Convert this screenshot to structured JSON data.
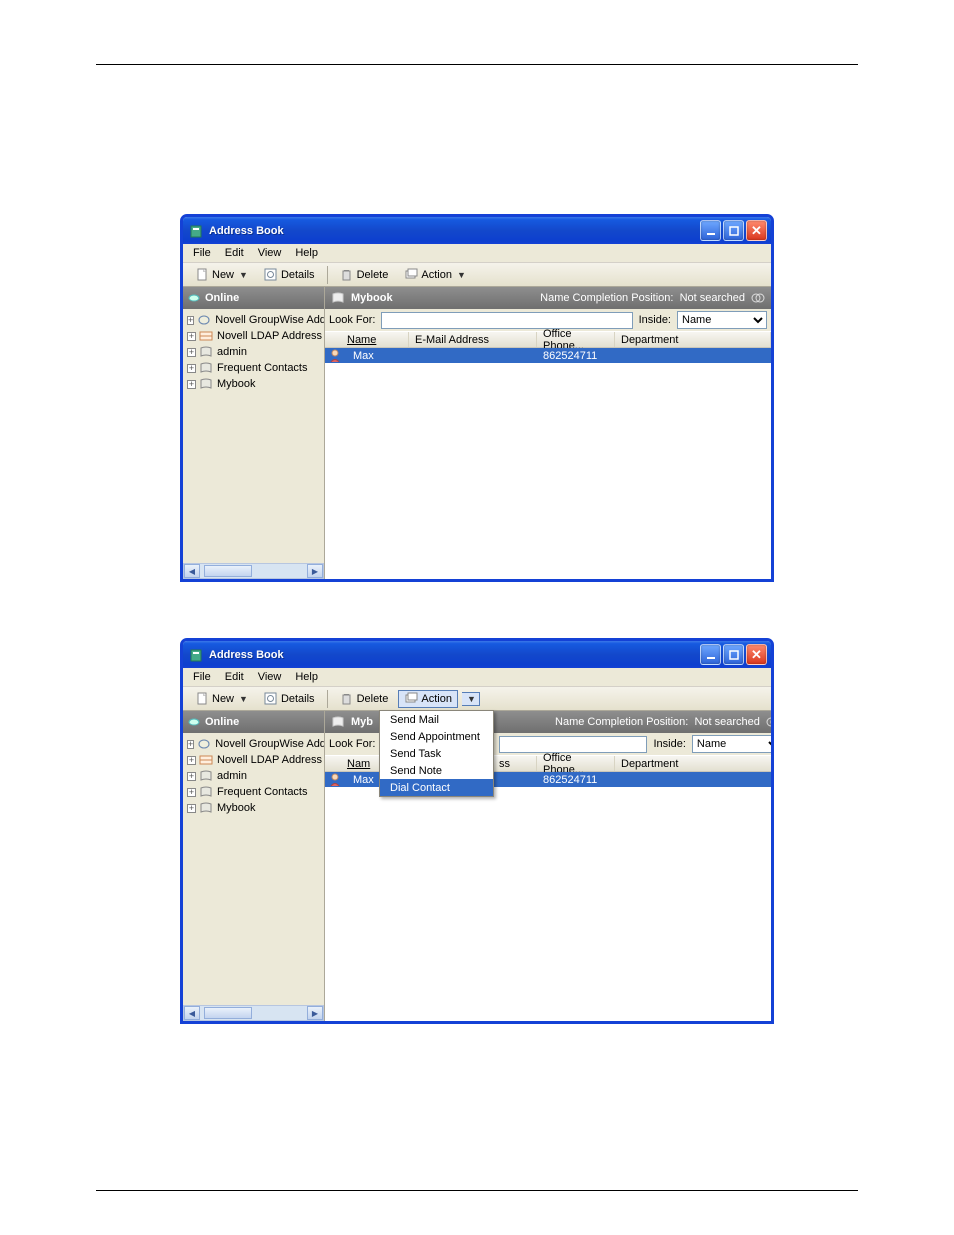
{
  "window": {
    "title": "Address Book"
  },
  "menubar": {
    "file": "File",
    "edit": "Edit",
    "view": "View",
    "help": "Help"
  },
  "toolbar": {
    "new": "New",
    "details": "Details",
    "delete": "Delete",
    "action": "Action"
  },
  "left": {
    "header": "Online",
    "items": [
      "Novell GroupWise Address Book",
      "Novell LDAP Address",
      "admin",
      "Frequent Contacts",
      "Mybook"
    ]
  },
  "right": {
    "header_title": "Mybook",
    "status_label": "Name Completion Position:",
    "status_value": "Not searched",
    "lookfor_label": "Look For:",
    "lookfor_value": "",
    "inside_label": "Inside:",
    "inside_value": "Name",
    "columns": {
      "name": "Name",
      "email": "E-Mail Address",
      "phone": "Office Phone...",
      "dept": "Department"
    },
    "row": {
      "name": "Max",
      "email": "",
      "phone": "862524711",
      "dept": ""
    }
  },
  "action_menu": {
    "items": [
      "Send Mail",
      "Send Appointment",
      "Send Task",
      "Send Note",
      "Dial Contact"
    ],
    "highlighted_index": 4
  },
  "right2": {
    "header_title_short": "Myb",
    "email_suffix": "ss",
    "col_name_short": "Nam"
  }
}
